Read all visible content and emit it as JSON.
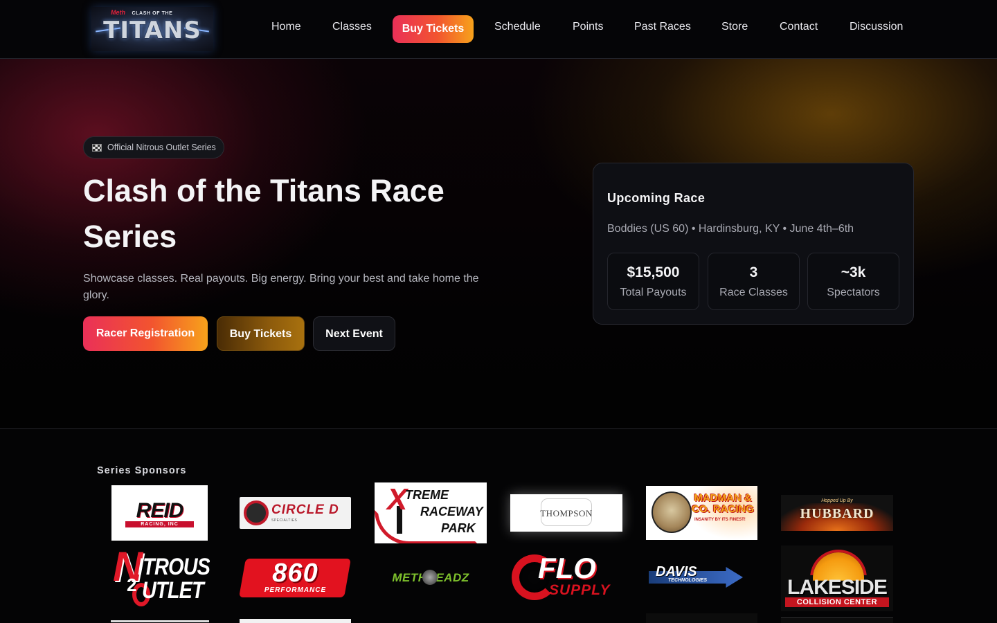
{
  "nav": {
    "logo": {
      "small_top": "CLASH OF THE",
      "brand_word": "Meth",
      "main": "TITANS",
      "alt": "Clash of the Titans logo"
    },
    "links": [
      "Home",
      "Classes",
      "Buy Tickets",
      "Schedule",
      "Points",
      "Past Races",
      "Store",
      "Contact",
      "Discussion"
    ],
    "active_cta": "Buy Tickets"
  },
  "hero": {
    "badge_icon": "checkered-flag-icon",
    "badge": "Official Nitrous Outlet Series",
    "title": "Clash of the Titans Race Series",
    "subtitle": "Showcase classes. Real payouts. Big energy. Bring your best and take home the glory.",
    "buttons": {
      "register": "Racer Registration",
      "tickets": "Buy Tickets",
      "next": "Next Event"
    },
    "colors": {
      "accent_gradient_start": "#ea3058",
      "accent_gradient_end": "#f7a21b",
      "gold": "#a8710e"
    }
  },
  "upcoming": {
    "title": "Upcoming Race",
    "venue": "Boddies (US 60)",
    "location": "Hardinsburg, KY",
    "dates": "June 4th–6th",
    "separator": "•",
    "stats": [
      {
        "value": "$15,500",
        "label": "Total Payouts"
      },
      {
        "value": "3",
        "label": "Race Classes"
      },
      {
        "value": "~3k",
        "label": "Spectators"
      }
    ]
  },
  "sponsors": {
    "title": "Series Sponsors",
    "logos": {
      "reid": {
        "main": "REID",
        "sub": "RACING, INC"
      },
      "circle_d": {
        "main": "CIRCLE D",
        "sub": "SPECIALTIES"
      },
      "xtreme": {
        "x": "X",
        "line1": "TREME",
        "line2": "RACEWAY",
        "line3": "PARK"
      },
      "thompson": {
        "main": "THOMPSON"
      },
      "madman": {
        "main": "MADMAN & CO. RACING",
        "sub": "INSANITY BY ITS FINEST!"
      },
      "hubbard": {
        "main": "HUBBARD",
        "sub": "Hopped Up By"
      },
      "nitrous": {
        "n": "N",
        "two": "2",
        "line1": "ITROUS",
        "line2": "UTLET"
      },
      "p860": {
        "main": "860",
        "sub": "PERFORMANCE"
      },
      "meth": {
        "main": "METHHEADZ"
      },
      "flo": {
        "main": "FLO",
        "sub": "SUPPLY"
      },
      "davis": {
        "main": "DAVIS",
        "sub": "TECHNOLOGIES"
      },
      "lakeside": {
        "main": "LAKESIDE",
        "sub": "COLLISION CENTER"
      }
    }
  }
}
